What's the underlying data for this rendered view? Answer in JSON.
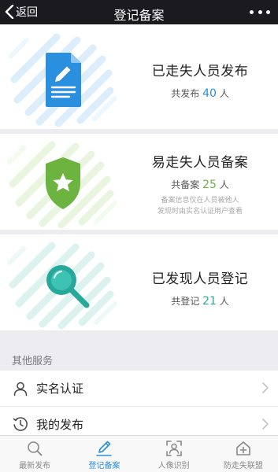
{
  "navbar": {
    "back_label": "返回",
    "title": "登记备案"
  },
  "cards": [
    {
      "title": "已走失人员发布",
      "stat_prefix": "共发布",
      "stat_count": "40",
      "stat_unit": "人",
      "icon": "document-edit-icon",
      "accent": "#2b8fe0"
    },
    {
      "title": "易走失人员备案",
      "stat_prefix": "共备案",
      "stat_count": "25",
      "stat_unit": "人",
      "note_line1": "备案信息仅在人员被他人",
      "note_line2": "发现时由实名认证用户查看",
      "icon": "shield-star-icon",
      "accent": "#6cb33f"
    },
    {
      "title": "已发现人员登记",
      "stat_prefix": "共登记",
      "stat_count": "21",
      "stat_unit": "人",
      "icon": "magnifier-icon",
      "accent": "#28a79b"
    }
  ],
  "other_services": {
    "header": "其他服务",
    "items": [
      {
        "label": "实名认证",
        "icon": "user-icon"
      },
      {
        "label": "我的发布",
        "icon": "history-icon"
      }
    ]
  },
  "tabbar": {
    "items": [
      {
        "label": "最新发布",
        "icon": "search-icon",
        "active": false
      },
      {
        "label": "登记备案",
        "icon": "pencil-icon",
        "active": true
      },
      {
        "label": "人像识别",
        "icon": "face-scan-icon",
        "active": false
      },
      {
        "label": "防走失联盟",
        "icon": "house-plus-icon",
        "active": false
      }
    ],
    "active_color": "#2b8fe0"
  }
}
